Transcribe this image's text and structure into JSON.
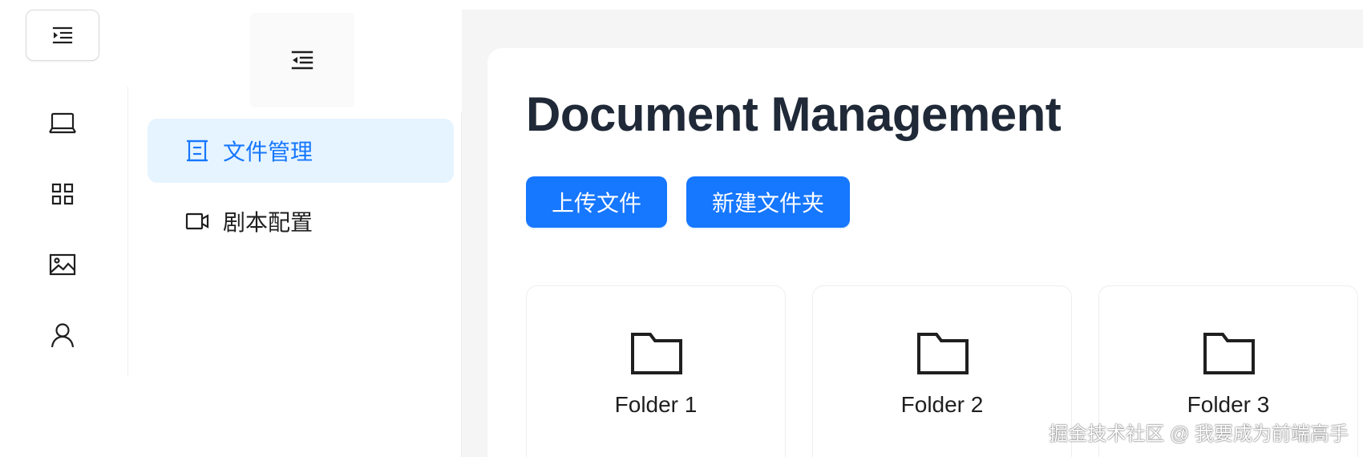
{
  "header": {
    "expand_icon": "menu-unfold-icon",
    "collapse_icon": "menu-fold-icon"
  },
  "rail": {
    "items": [
      {
        "icon": "laptop-icon"
      },
      {
        "icon": "grid-icon"
      },
      {
        "icon": "image-icon"
      },
      {
        "icon": "user-icon"
      }
    ]
  },
  "nav": {
    "items": [
      {
        "label": "文件管理",
        "icon": "file-frame-icon",
        "active": true
      },
      {
        "label": "剧本配置",
        "icon": "video-camera-icon",
        "active": false
      }
    ]
  },
  "main": {
    "title": "Document Management",
    "buttons": {
      "upload_label": "上传文件",
      "new_folder_label": "新建文件夹"
    },
    "folders": [
      {
        "name": "Folder 1",
        "icon": "folder-icon"
      },
      {
        "name": "Folder 2",
        "icon": "folder-icon"
      },
      {
        "name": "Folder 3",
        "icon": "folder-icon"
      }
    ]
  },
  "watermark": "掘金技术社区 @ 我要成为前端高手",
  "colors": {
    "primary": "#1677ff",
    "active_bg": "#e6f4ff",
    "content_bg": "#f5f5f5",
    "title": "#1f2937"
  }
}
